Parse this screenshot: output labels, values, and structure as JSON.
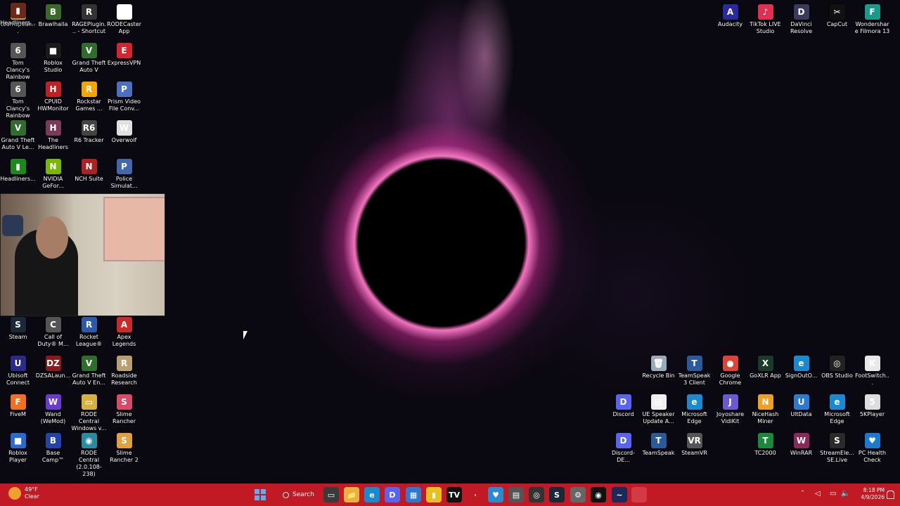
{
  "desktop": {
    "left_icons": [
      {
        "label": "teamspeak...",
        "glyph": "📁",
        "color": "#e8b23d",
        "icon": "folder-icon"
      },
      {
        "label": "Brawlhalla",
        "glyph": "B",
        "color": "#3a6a2a",
        "icon": "brawlhalla-icon"
      },
      {
        "label": "RAGEPlugin... - Shortcut",
        "glyph": "R",
        "color": "#333",
        "icon": "rageplugin-icon"
      },
      {
        "label": "RODECaster App",
        "glyph": "◉",
        "color": "#ffffff",
        "icon": "rodecaster-icon"
      },
      {
        "label": "Tom Clancy's Rainbow Si...",
        "glyph": "6",
        "color": "#555",
        "icon": "rainbow-six-icon"
      },
      {
        "label": "Roblox Studio",
        "glyph": "■",
        "color": "#1a1a1a",
        "icon": "roblox-studio-icon"
      },
      {
        "label": "Grand Theft Auto V",
        "glyph": "V",
        "color": "#2f6d2f",
        "icon": "gta-v-icon"
      },
      {
        "label": "ExpressVPN",
        "glyph": "E",
        "color": "#d6242f",
        "icon": "expressvpn-icon"
      },
      {
        "label": "Tom Clancy's Rainbow Si...",
        "glyph": "6",
        "color": "#555",
        "icon": "rainbow-six-icon"
      },
      {
        "label": "CPUID HWMonitor",
        "glyph": "H",
        "color": "#c02020",
        "icon": "hwmonitor-icon"
      },
      {
        "label": "Rockstar Games ...",
        "glyph": "R",
        "color": "#f2a600",
        "icon": "rockstar-icon"
      },
      {
        "label": "Prism Video File Conv...",
        "glyph": "P",
        "color": "#4a70c0",
        "icon": "prism-icon"
      },
      {
        "label": "Grand Theft Auto V Le...",
        "glyph": "V",
        "color": "#2f6d2f",
        "icon": "gta-v-icon"
      },
      {
        "label": "The Headliners",
        "glyph": "H",
        "color": "#7a3a5a",
        "icon": "headliners-icon"
      },
      {
        "label": "R6 Tracker",
        "glyph": "R6",
        "color": "#444",
        "icon": "r6-tracker-icon"
      },
      {
        "label": "Overwolf",
        "glyph": "W",
        "color": "#e0e0e0",
        "icon": "overwolf-icon"
      },
      {
        "label": "Headliners...",
        "glyph": "▮",
        "color": "#1a8a1a",
        "icon": "headliners-icon"
      },
      {
        "label": "NVIDIA GeFor...",
        "glyph": "N",
        "color": "#76b900",
        "icon": "nvidia-icon"
      },
      {
        "label": "NCH Suite",
        "glyph": "N",
        "color": "#aa2222",
        "icon": "nch-icon"
      },
      {
        "label": "Police Simulat...",
        "glyph": "P",
        "color": "#4466aa",
        "icon": "police-sim-icon"
      },
      {
        "label": "Headliners...",
        "glyph": "▮",
        "color": "#6a2a1a",
        "icon": "headliners-icon"
      },
      {
        "label": "Steam",
        "glyph": "S",
        "color": "#1b2838",
        "icon": "steam-icon"
      },
      {
        "label": "Call of Duty® M...",
        "glyph": "C",
        "color": "#555",
        "icon": "cod-icon"
      },
      {
        "label": "Rocket League®",
        "glyph": "R",
        "color": "#2a5aa8",
        "icon": "rocket-league-icon"
      },
      {
        "label": "Apex Legends",
        "glyph": "A",
        "color": "#c92a2a",
        "icon": "apex-icon"
      },
      {
        "label": "Ubisoft Connect",
        "glyph": "U",
        "color": "#2a2a8a",
        "icon": "ubisoft-icon"
      },
      {
        "label": "DZSALaun...",
        "glyph": "DZ",
        "color": "#8a1a1a",
        "icon": "dzsa-icon"
      },
      {
        "label": "Grand Theft Auto V En...",
        "glyph": "V",
        "color": "#2f6d2f",
        "icon": "gta-v-icon"
      },
      {
        "label": "Roadside Research",
        "glyph": "R",
        "color": "#b8a070",
        "icon": "roadside-icon"
      },
      {
        "label": "FiveM",
        "glyph": "F",
        "color": "#f07020",
        "icon": "fivem-icon"
      },
      {
        "label": "Wand (WeMod)",
        "glyph": "W",
        "color": "#6a3ad0",
        "icon": "wand-icon"
      },
      {
        "label": "RODE Central Windows v...",
        "glyph": "▭",
        "color": "#d8b040",
        "icon": "rode-central-icon"
      },
      {
        "label": "Slime Rancher",
        "glyph": "S",
        "color": "#d84a6a",
        "icon": "slime-rancher-icon"
      },
      {
        "label": "Roblox Player",
        "glyph": "■",
        "color": "#2a6ad0",
        "icon": "roblox-icon"
      },
      {
        "label": "Base Camp™",
        "glyph": "B",
        "color": "#2244aa",
        "icon": "base-camp-icon"
      },
      {
        "label": "RODE Central (2.0.108-238)",
        "glyph": "◉",
        "color": "#2a8aa0",
        "icon": "rode-central-icon"
      },
      {
        "label": "Slime Rancher 2",
        "glyph": "S",
        "color": "#e0a040",
        "icon": "slime-rancher-2-icon"
      }
    ],
    "right_icons": [
      {
        "label": "Audacity",
        "glyph": "A",
        "color": "#2a2aa0",
        "icon": "audacity-icon"
      },
      {
        "label": "TikTok LIVE Studio",
        "glyph": "♪",
        "color": "#e03050",
        "icon": "tiktok-icon"
      },
      {
        "label": "DaVinci Resolve",
        "glyph": "D",
        "color": "#3a3a5a",
        "icon": "davinci-icon"
      },
      {
        "label": "CapCut",
        "glyph": "✂",
        "color": "#111",
        "icon": "capcut-icon"
      },
      {
        "label": "Wondershare Filmora 13",
        "glyph": "F",
        "color": "#1a9a8a",
        "icon": "filmora-icon"
      },
      {
        "label": "Recycle Bin",
        "glyph": "🗑",
        "color": "#9ab",
        "icon": "recycle-bin-icon"
      },
      {
        "label": "TeamSpeak 3 Client",
        "glyph": "T",
        "color": "#2a5a9a",
        "icon": "teamspeak-icon"
      },
      {
        "label": "Google Chrome",
        "glyph": "●",
        "color": "#db4437",
        "icon": "chrome-icon"
      },
      {
        "label": "GoXLR App",
        "glyph": "X",
        "color": "#1a3a2a",
        "icon": "goxlr-icon"
      },
      {
        "label": "SignOutO...",
        "glyph": "e",
        "color": "#1a8ad0",
        "icon": "edge-icon"
      },
      {
        "label": "OBS Studio",
        "glyph": "◎",
        "color": "#222",
        "icon": "obs-icon"
      },
      {
        "label": "FootSwitch...",
        "glyph": "K",
        "color": "#e8e8e8",
        "icon": "footswitch-icon"
      },
      {
        "label": "Discord",
        "glyph": "D",
        "color": "#5865f2",
        "icon": "discord-icon"
      },
      {
        "label": "UE Speaker Update A...",
        "glyph": "▤",
        "color": "#f0f0f0",
        "icon": "ue-speaker-icon"
      },
      {
        "label": "Microsoft Edge",
        "glyph": "e",
        "color": "#1a8ad0",
        "icon": "edge-icon"
      },
      {
        "label": "Joyoshare VidiKit",
        "glyph": "J",
        "color": "#6a5ad0",
        "icon": "joyoshare-icon"
      },
      {
        "label": "NiceHash Miner",
        "glyph": "N",
        "color": "#f0a020",
        "icon": "nicehash-icon"
      },
      {
        "label": "UltData",
        "glyph": "U",
        "color": "#2a7ad0",
        "icon": "ultdata-icon"
      },
      {
        "label": "Microsoft Edge",
        "glyph": "e",
        "color": "#1a8ad0",
        "icon": "edge-icon"
      },
      {
        "label": "5KPlayer",
        "glyph": "5",
        "color": "#ddd",
        "icon": "5kplayer-icon"
      },
      {
        "label": "Discord-DE...",
        "glyph": "D",
        "color": "#5865f2",
        "icon": "discord-icon"
      },
      {
        "label": "TeamSpeak",
        "glyph": "T",
        "color": "#2a5a9a",
        "icon": "teamspeak-icon"
      },
      {
        "label": "SteamVR",
        "glyph": "VR",
        "color": "#555",
        "icon": "steamvr-icon"
      },
      {
        "label": "TC2000",
        "glyph": "T",
        "color": "#1a8a3a",
        "icon": "tc2000-icon"
      },
      {
        "label": "WinRAR",
        "glyph": "W",
        "color": "#8a2a5a",
        "icon": "winrar-icon"
      },
      {
        "label": "StreamEle... SE.Live",
        "glyph": "S",
        "color": "#2a2a2a",
        "icon": "streamelements-icon"
      },
      {
        "label": "PC Health Check",
        "glyph": "♥",
        "color": "#1a7ad0",
        "icon": "pc-health-icon"
      }
    ]
  },
  "taskbar": {
    "weather": {
      "temp": "49°F",
      "condition": "Clear"
    },
    "search_label": "Search",
    "pinned": [
      {
        "glyph": "▭",
        "color": "#3a3a3a",
        "icon": "task-view-icon"
      },
      {
        "glyph": "📁",
        "color": "#e8b23d",
        "icon": "file-explorer-icon"
      },
      {
        "glyph": "e",
        "color": "#1a8ad0",
        "icon": "edge-icon"
      },
      {
        "glyph": "D",
        "color": "#5865f2",
        "icon": "discord-icon"
      },
      {
        "glyph": "▦",
        "color": "#2a7ad0",
        "icon": "photos-icon"
      },
      {
        "glyph": "▮",
        "color": "#e8c020",
        "icon": "sticky-notes-icon"
      },
      {
        "glyph": "TV",
        "color": "#111",
        "icon": "tradingview-icon"
      },
      {
        "glyph": "·",
        "color": "#c11a24",
        "icon": "blank-icon"
      },
      {
        "glyph": "♥",
        "color": "#2a8ad0",
        "icon": "health-icon"
      },
      {
        "glyph": "▤",
        "color": "#555",
        "icon": "calculator-icon"
      },
      {
        "glyph": "◎",
        "color": "#333",
        "icon": "obs-icon"
      },
      {
        "glyph": "S",
        "color": "#1b2838",
        "icon": "steam-icon"
      },
      {
        "glyph": "⚙",
        "color": "#666",
        "icon": "settings-icon"
      },
      {
        "glyph": "◉",
        "color": "#111",
        "icon": "rodecaster-icon"
      },
      {
        "glyph": "~",
        "color": "#1a2a5a",
        "icon": "vpn-icon"
      },
      {
        "glyph": "",
        "color": "#d23a44",
        "icon": "active-app-icon"
      }
    ],
    "clock": {
      "time": "8:18 PM",
      "date": "4/9/2026"
    }
  }
}
